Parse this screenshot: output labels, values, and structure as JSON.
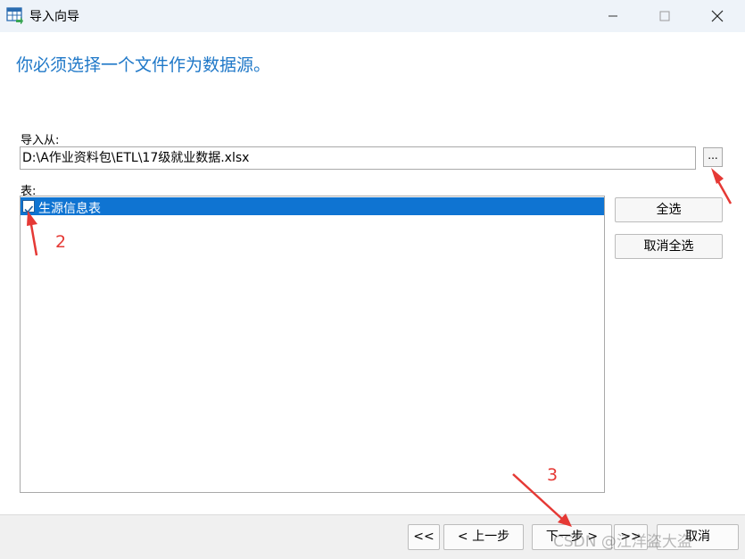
{
  "window": {
    "title": "导入向导"
  },
  "heading": "你必须选择一个文件作为数据源。",
  "import_from": {
    "label": "导入从:",
    "value": "D:\\A作业资料包\\ETL\\17级就业数据.xlsx",
    "browse_label": "..."
  },
  "tables": {
    "label": "表:",
    "items": [
      {
        "label": "生源信息表",
        "checked": true
      }
    ],
    "select_all": "全选",
    "deselect_all": "取消全选"
  },
  "footer": {
    "first": "<<",
    "prev": "< 上一步",
    "next": "下一步 >",
    "last": ">>",
    "cancel": "取消"
  },
  "annotations": {
    "n2": "2",
    "n3": "3"
  },
  "watermark": "CSDN @江洋盗大盗",
  "colors": {
    "accent": "#1f78c8",
    "selection": "#0f74d2",
    "annotation": "#e53935"
  }
}
